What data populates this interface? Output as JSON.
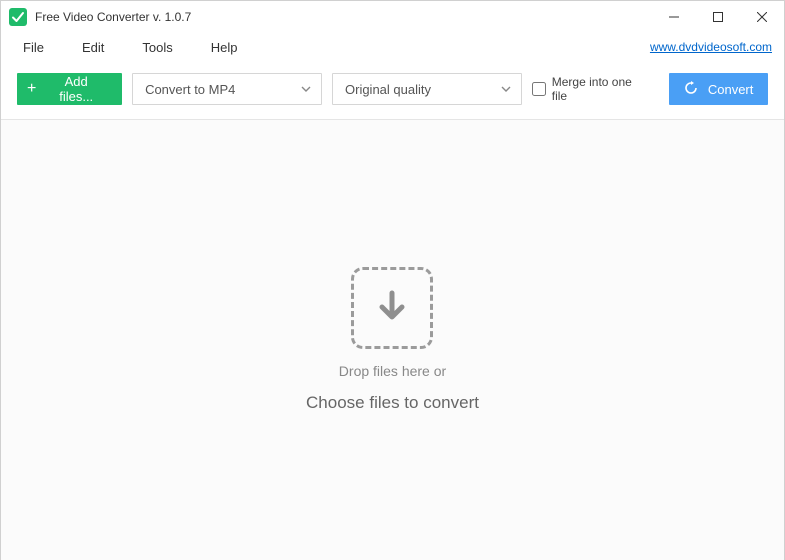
{
  "titlebar": {
    "title": "Free Video Converter v. 1.0.7"
  },
  "menubar": {
    "file": "File",
    "edit": "Edit",
    "tools": "Tools",
    "help": "Help",
    "site_link": "www.dvdvideosoft.com"
  },
  "toolbar": {
    "add_files_label": "Add files...",
    "format_selected": "Convert to MP4",
    "quality_selected": "Original quality",
    "merge_label": "Merge into one file",
    "convert_label": "Convert"
  },
  "dropzone": {
    "line1": "Drop files here or",
    "line2": "Choose files to convert"
  }
}
